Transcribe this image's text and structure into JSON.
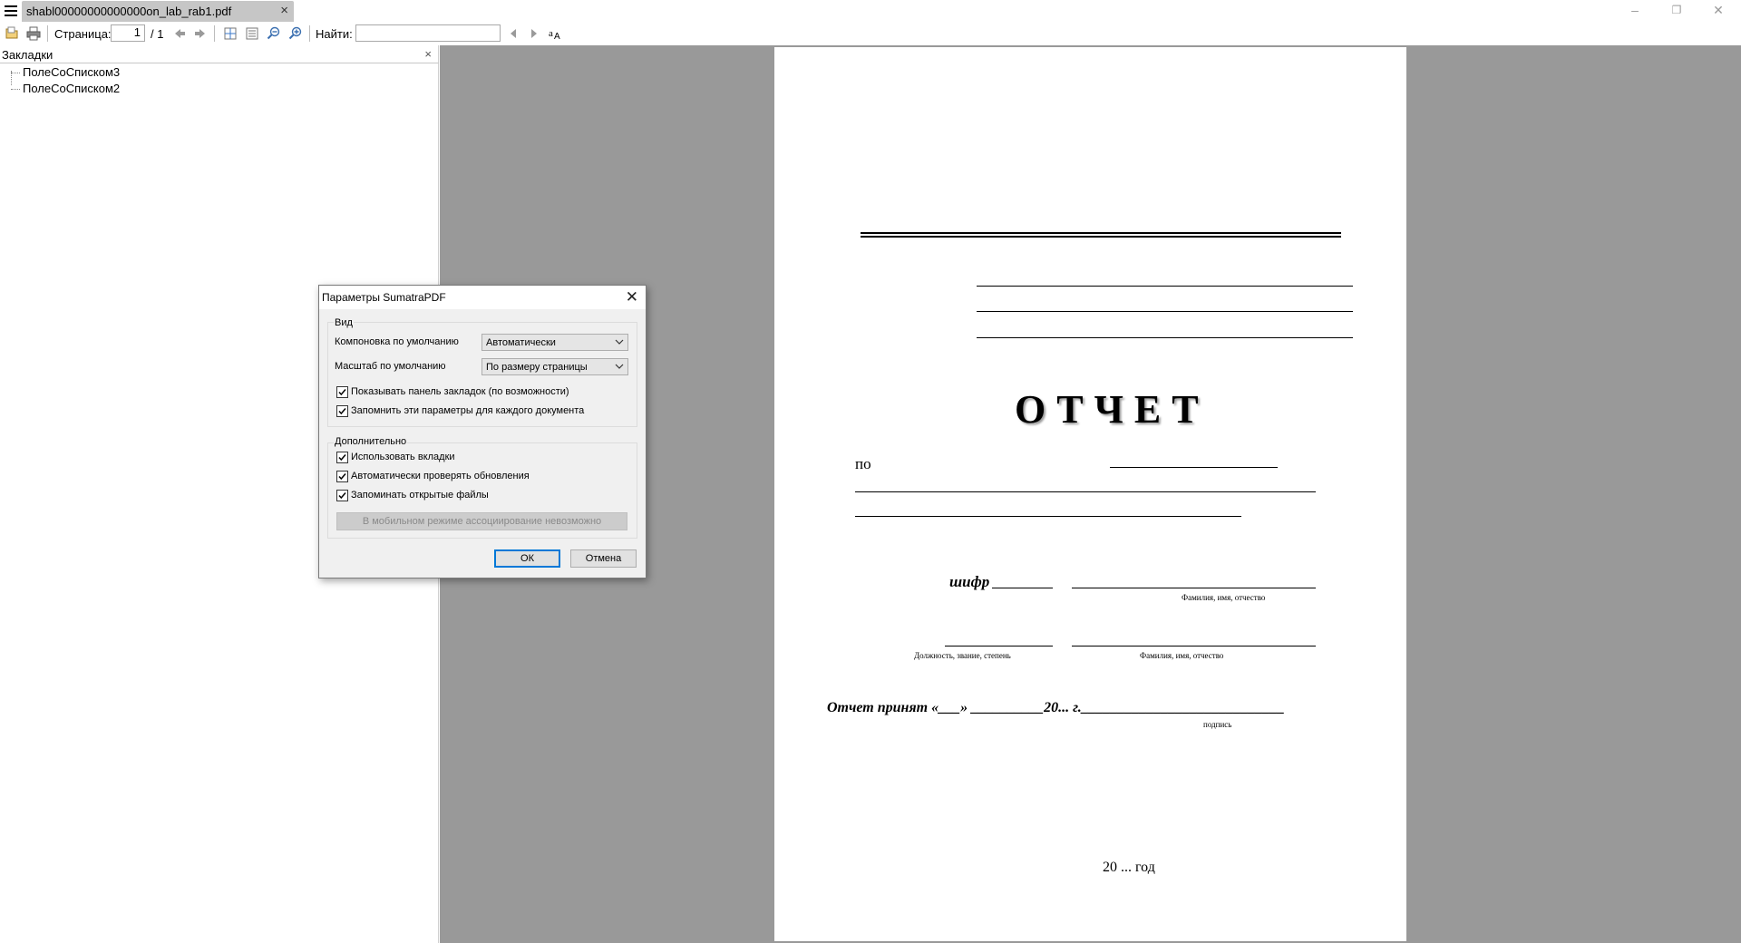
{
  "tab": {
    "title": "shabl00000000000000on_lab_rab1.pdf",
    "close_glyph": "×"
  },
  "window_controls": {
    "minimize": "–",
    "restore": "❐",
    "close": "✕"
  },
  "toolbar": {
    "page_label": "Страница:",
    "page_current": "1",
    "page_total": "/ 1",
    "find_label": "Найти:",
    "find_value": ""
  },
  "sidebar": {
    "title": "Закладки",
    "close_glyph": "×",
    "bookmarks": [
      "ПолеСоСписком3",
      "ПолеСоСписком2"
    ]
  },
  "document": {
    "title": "ОТЧЕТ",
    "po": "по",
    "shifr": "шифр",
    "fio_caption_1": "Фамилия, имя, отчество",
    "dolzhnost_caption": "Должность, звание, степень",
    "fio_caption_2": "Фамилия, имя, отчество",
    "accepted_line": "Отчет принят «___» __________20... г.____________________________",
    "signature_caption": "подпись",
    "year": "20 ... год"
  },
  "dialog": {
    "title": "Параметры SumatraPDF",
    "close_glyph": "✕",
    "view_group": "Вид",
    "layout_label": "Компоновка по умолчанию",
    "layout_value": "Автоматически",
    "zoom_label": "Масштаб по умолчанию",
    "zoom_value": "По размеру страницы",
    "cb_show_bookmarks": "Показывать панель закладок (по возможности)",
    "cb_remember_params": "Запомнить эти параметры для каждого документа",
    "advanced_group": "Дополнительно",
    "cb_use_tabs": "Использовать вкладки",
    "cb_check_updates": "Автоматически проверять обновления",
    "cb_remember_files": "Запоминать открытые файлы",
    "assoc_button": "В мобильном режиме ассоциирование невозможно",
    "ok": "ОК",
    "cancel": "Отмена"
  },
  "colors": {
    "canvas_bg": "#999999",
    "focus_blue": "#0078d7",
    "tab_bg": "#c6c6c6",
    "dialog_bg": "#f0f0f0"
  },
  "icons": [
    "menu-icon",
    "open-file-icon",
    "print-icon",
    "prev-page-icon",
    "next-page-icon",
    "fit-page-icon",
    "fit-width-icon",
    "zoom-out-icon",
    "zoom-in-icon",
    "find-prev-icon",
    "find-next-icon",
    "match-case-icon"
  ]
}
